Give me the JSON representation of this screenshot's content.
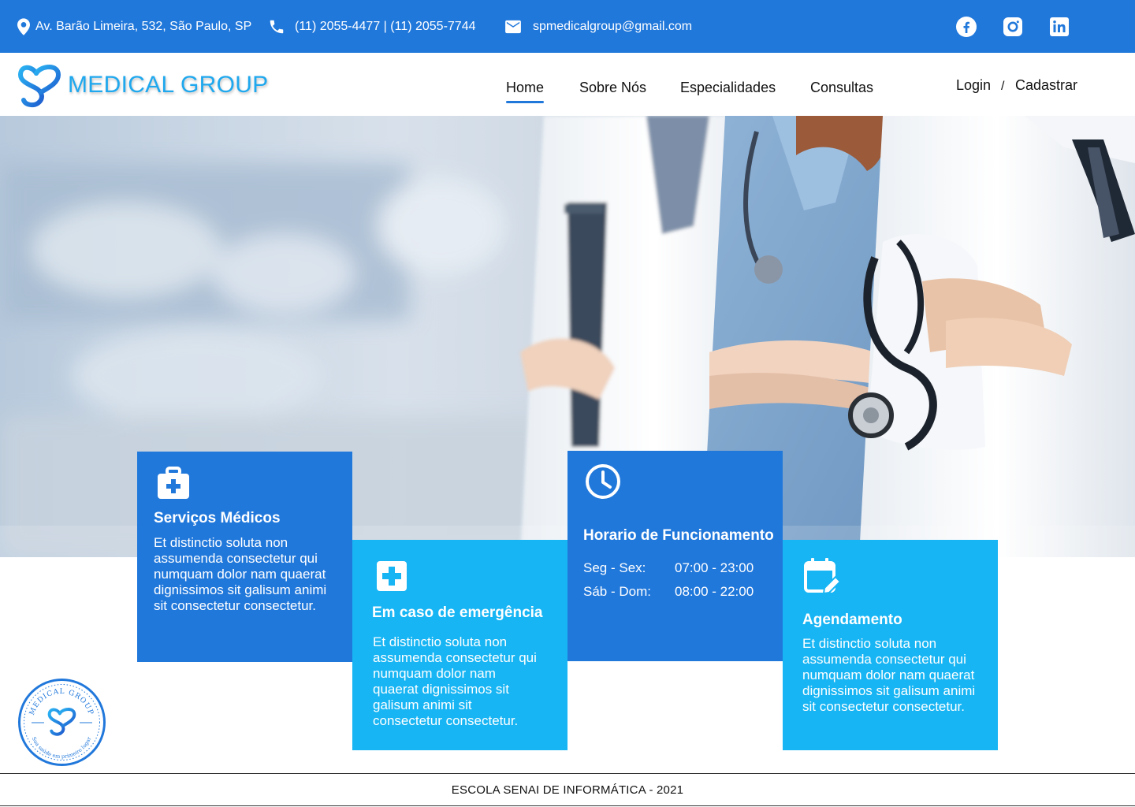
{
  "topbar": {
    "address": "Av. Barão Limeira, 532, São Paulo, SP",
    "phones": "(11) 2055-4477 | (11) 2055-7744",
    "email": "spmedicalgroup@gmail.com",
    "icons": {
      "address": "map-pin-icon",
      "phone": "phone-icon",
      "email": "mail-icon"
    },
    "social": [
      "facebook-icon",
      "instagram-icon",
      "linkedin-icon"
    ],
    "background": "#2178db"
  },
  "header": {
    "logo_text": "MEDICAL GROUP",
    "nav": {
      "home": "Home",
      "sobre": "Sobre Nós",
      "especialidades": "Especialidades",
      "consultas": "Consultas"
    },
    "active_nav": "Home",
    "auth": {
      "login": "Login",
      "separator": "/",
      "cadastrar": "Cadastrar"
    }
  },
  "cards": {
    "servicos": {
      "icon": "medical-bag-icon",
      "title": "Serviços Médicos",
      "text": "Et distinctio soluta non assumenda consectetur qui numquam dolor nam quaerat dignissimos sit galisum animi sit consectetur consectetur."
    },
    "emergencia": {
      "icon": "medical-cross-icon",
      "title": "Em caso de emergência",
      "text": "Et distinctio soluta non assumenda consectetur qui numquam dolor nam quaerat dignissimos sit galisum animi sit consectetur consectetur."
    },
    "horario": {
      "icon": "clock-icon",
      "title": "Horario de Funcionamento",
      "rows": [
        {
          "days": "Seg - Sex:",
          "time": "07:00 - 23:00"
        },
        {
          "days": "Sáb - Dom:",
          "time": "08:00 - 22:00"
        }
      ]
    },
    "agendamento": {
      "icon": "calendar-edit-icon",
      "title": "Agendamento",
      "text": "Et distinctio soluta non assumenda consectetur qui numquam dolor nam quaerat dignissimos sit galisum animi sit consectetur consectetur."
    }
  },
  "seal": {
    "top_text": "MEDICAL GROUP",
    "bottom_text": "Sua saúde em primeiro lugar"
  },
  "footer": {
    "text": "ESCOLA SENAI DE INFORMÁTICA - 2021"
  },
  "colors": {
    "primary": "#2178db",
    "light": "#17b5f4",
    "logo": "#1fa8ee"
  }
}
